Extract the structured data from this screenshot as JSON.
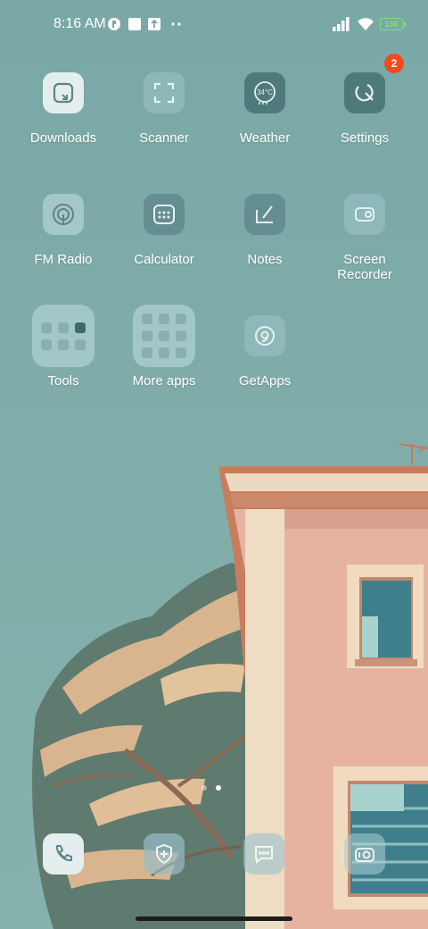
{
  "status_bar": {
    "time": "8:16 AM",
    "battery": "100",
    "icons": [
      "notification-app-icon",
      "square-notification-icon",
      "upload-notification-icon",
      "more-dots-icon",
      "signal-icon",
      "wifi-icon",
      "battery-icon"
    ]
  },
  "apps": [
    {
      "label": "Downloads",
      "icon": "downloads-icon"
    },
    {
      "label": "Scanner",
      "icon": "scanner-icon"
    },
    {
      "label": "Weather",
      "icon": "weather-icon",
      "icon_text": "34°C"
    },
    {
      "label": "Settings",
      "icon": "settings-icon",
      "badge": "2"
    },
    {
      "label": "FM Radio",
      "icon": "fm-radio-icon"
    },
    {
      "label": "Calculator",
      "icon": "calculator-icon"
    },
    {
      "label": "Notes",
      "icon": "notes-icon"
    },
    {
      "label": "Screen Recorder",
      "icon": "screen-recorder-icon"
    },
    {
      "label": "Tools",
      "icon": "folder-icon"
    },
    {
      "label": "More apps",
      "icon": "folder-icon"
    },
    {
      "label": "GetApps",
      "icon": "getapps-icon"
    }
  ],
  "dock": [
    "phone-icon",
    "security-shield-icon",
    "messages-icon",
    "camera-icon"
  ],
  "page_indicator": {
    "current": 2,
    "total": 2
  },
  "colors": {
    "sky": "#7aa6a4",
    "accent_badge": "#f24a1c",
    "building": "#e9b5a3",
    "battery": "#7ee07c"
  }
}
